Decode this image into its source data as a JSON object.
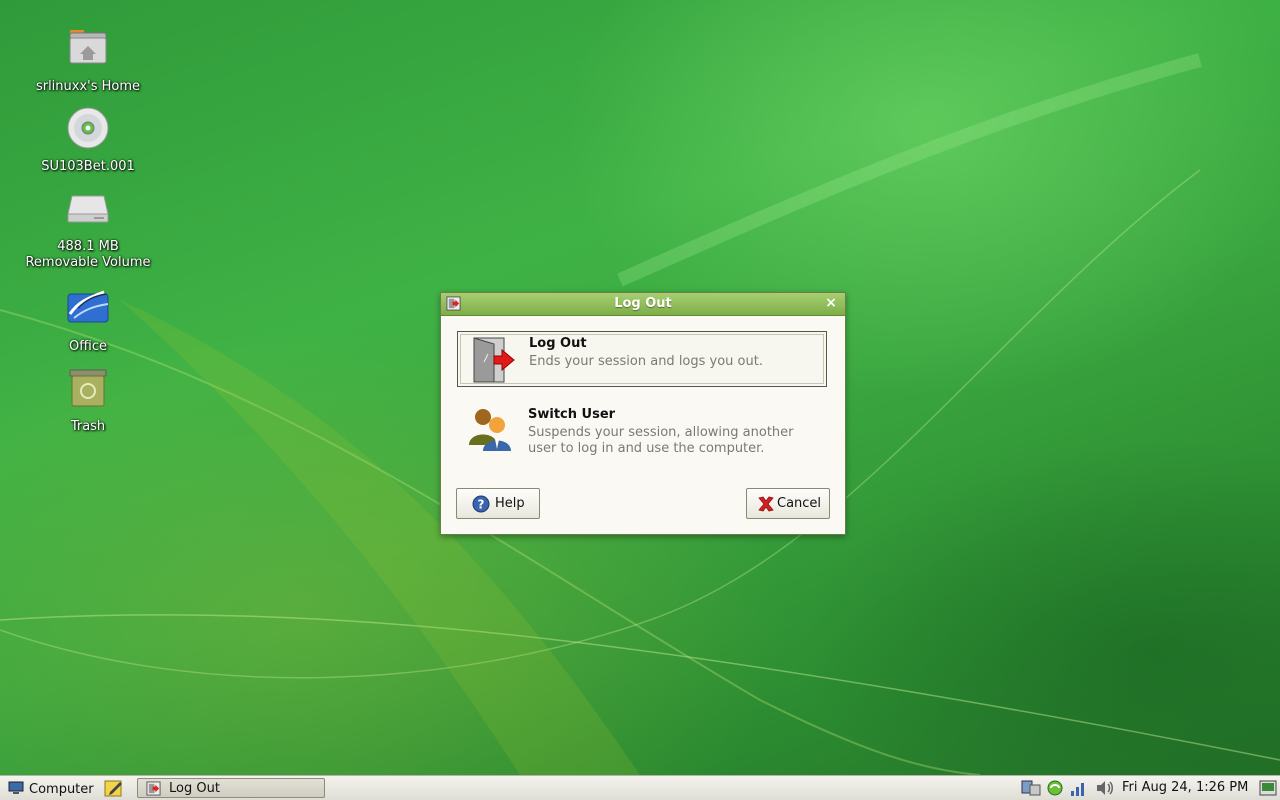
{
  "desktop": {
    "icons": [
      {
        "label": "srlinuxx's Home",
        "icon": "home-folder-icon"
      },
      {
        "label": "SU103Bet.001",
        "icon": "cd-disc-icon"
      },
      {
        "label": "488.1 MB\nRemovable Volume",
        "icon": "removable-drive-icon"
      },
      {
        "label": "Office",
        "icon": "office-suite-icon"
      },
      {
        "label": "Trash",
        "icon": "trash-icon"
      }
    ]
  },
  "dialog": {
    "title": "Log Out",
    "options": [
      {
        "title": "Log Out",
        "description": "Ends your session and logs you out.",
        "icon": "logout-door-icon"
      },
      {
        "title": "Switch User",
        "description": "Suspends your session, allowing another user to log in and use the computer.",
        "icon": "switch-user-icon"
      }
    ],
    "help_label": "Help",
    "cancel_label": "Cancel"
  },
  "panel": {
    "menu_label": "Computer",
    "task_label": "Log Out",
    "clock": "Fri Aug 24,  1:26 PM"
  },
  "colors": {
    "desktop_green": "#3fb245",
    "titlebar_green": "#8fbf5a",
    "dialog_bg": "#fbf9f4"
  }
}
